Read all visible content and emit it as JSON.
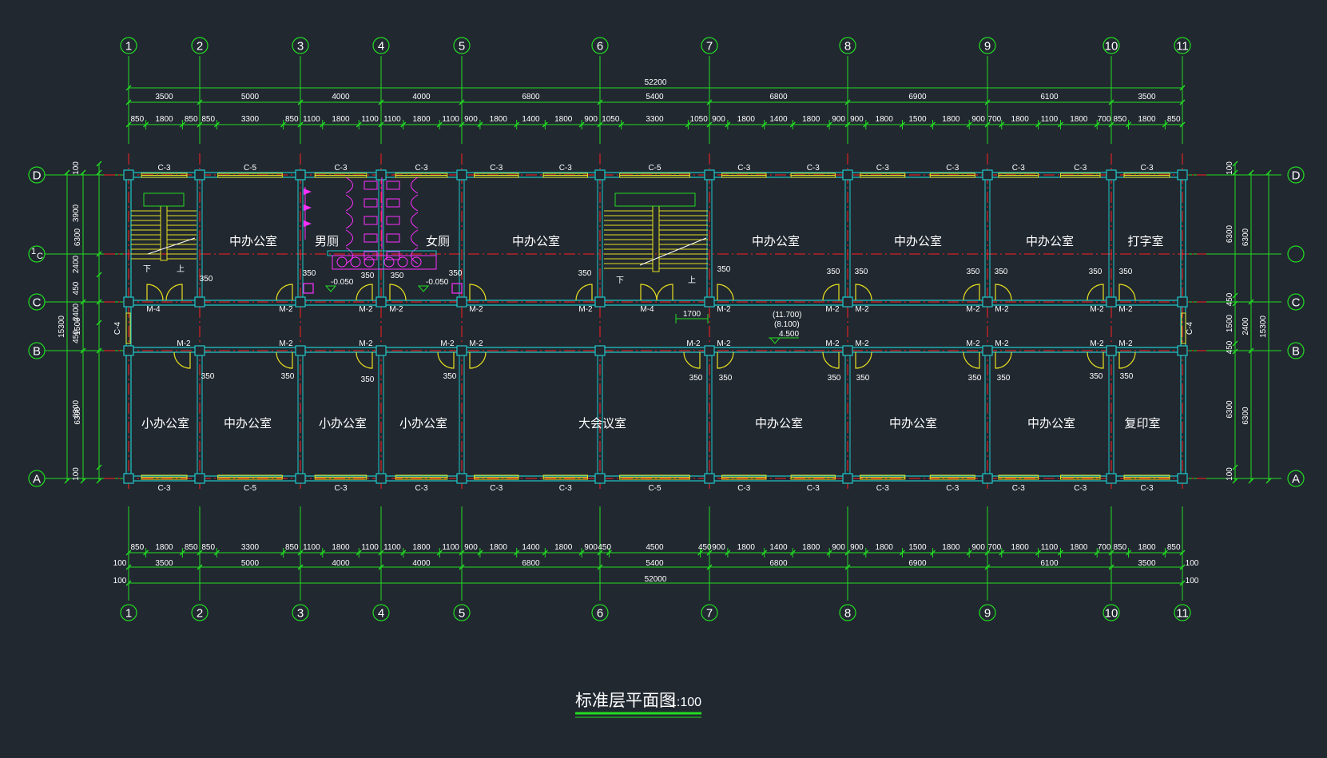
{
  "drawing": {
    "title": "标准层平面图",
    "scale": "1:100",
    "colors": {
      "background": "#212830",
      "axis": "#22dd22",
      "wall": "#20c8c8",
      "window": "#e8e020",
      "door": "#e8e020",
      "centerline": "#ff2020",
      "fixtures": "#ff30ff",
      "text": "#ffffff"
    }
  },
  "axes": {
    "columns": [
      "1",
      "2",
      "3",
      "4",
      "5",
      "6",
      "7",
      "8",
      "9",
      "10",
      "11"
    ],
    "rows": [
      {
        "label": "D",
        "sub": ""
      },
      {
        "label": "1",
        "sub": "C"
      },
      {
        "label": "C",
        "sub": ""
      },
      {
        "label": "B",
        "sub": ""
      },
      {
        "label": "A",
        "sub": ""
      }
    ]
  },
  "dimensions": {
    "top_total": "52200",
    "top_bays": [
      "3500",
      "5000",
      "4000",
      "4000",
      "6800",
      "5400",
      "6800",
      "6900",
      "6100",
      "3500"
    ],
    "top_detail": [
      "850",
      "1800",
      "850",
      "850",
      "3300",
      "850",
      "1100",
      "1800",
      "1100",
      "1100",
      "1800",
      "1100",
      "900",
      "1800",
      "1400",
      "1800",
      "900",
      "1050",
      "3300",
      "1050",
      "900",
      "1800",
      "1400",
      "1800",
      "900",
      "900",
      "1800",
      "1500",
      "1800",
      "900",
      "700",
      "1800",
      "1100",
      "1800",
      "700",
      "850",
      "1800",
      "850"
    ],
    "bottom_detail": [
      "850",
      "1800",
      "850",
      "850",
      "3300",
      "850",
      "1100",
      "1800",
      "1100",
      "1100",
      "1800",
      "1100",
      "900",
      "1800",
      "1400",
      "1800",
      "900",
      "450",
      "4500",
      "450",
      "900",
      "1800",
      "1400",
      "1800",
      "900",
      "900",
      "1800",
      "1500",
      "1800",
      "900",
      "700",
      "1800",
      "1100",
      "1800",
      "700",
      "850",
      "1800",
      "850"
    ],
    "bottom_bays": [
      "3500",
      "5000",
      "4000",
      "4000",
      "6800",
      "5400",
      "6800",
      "6900",
      "6100",
      "3500"
    ],
    "bottom_total": "52000",
    "bottom_ext": "100",
    "left_outer": "15300",
    "left_mid": [
      "6300",
      "1500",
      "6300"
    ],
    "left_inner": [
      "100",
      "3900",
      "2400",
      "450",
      "2400",
      "450",
      "6300",
      "100"
    ],
    "right_outer": "15300",
    "right_mid": [
      "6300",
      "2400",
      "6300"
    ],
    "right_inner": [
      "100",
      "6300",
      "450",
      "1500",
      "450",
      "6300",
      "100"
    ],
    "corridor": "1700",
    "w350": "350"
  },
  "windows": {
    "top": [
      "C-3",
      "C-5",
      "C-3",
      "C-3",
      "C-3",
      "C-3",
      "C-5",
      "C-3",
      "C-3",
      "C-3",
      "C-3",
      "C-3",
      "C-3",
      "C-3"
    ],
    "bottom": [
      "C-3",
      "C-5",
      "C-3",
      "C-3",
      "C-3",
      "C-3",
      "C-5",
      "C-3",
      "C-3",
      "C-3",
      "C-3",
      "C-3",
      "C-3",
      "C-3"
    ],
    "end": "C-4"
  },
  "doors": {
    "m2": "M-2",
    "m4": "M-4"
  },
  "rooms": {
    "north": [
      "中办公室",
      "男厕",
      "女厕",
      "中办公室",
      "中办公室",
      "中办公室",
      "中办公室",
      "打字室"
    ],
    "south": [
      "小办公室",
      "中办公室",
      "小办公室",
      "小办公室",
      "大会议室",
      "中办公室",
      "中办公室",
      "中办公室",
      "复印室"
    ]
  },
  "stairs": {
    "down": "下",
    "up": "上"
  },
  "elevations": {
    "toilet": "-0.050",
    "floor_list": [
      "(11.700)",
      "(8.100)",
      "4.500"
    ]
  }
}
